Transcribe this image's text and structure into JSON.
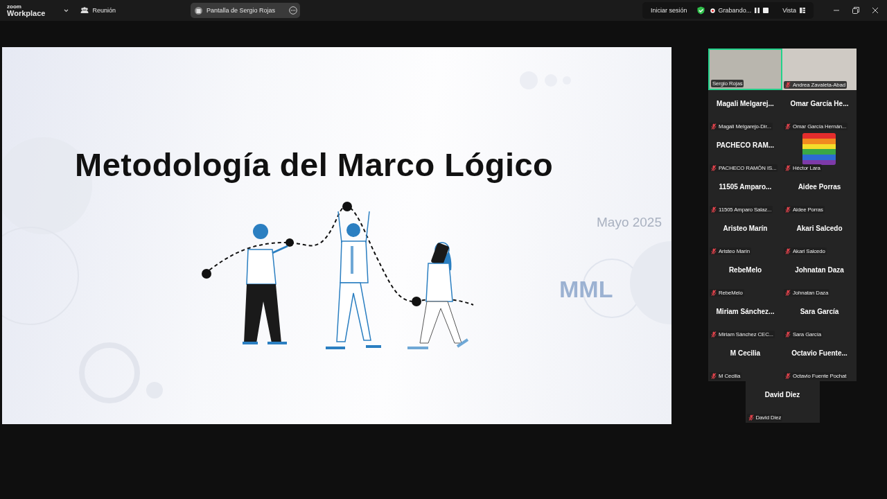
{
  "top_bar": {
    "brand_small": "zoom",
    "brand": "Workplace",
    "meeting_label": "Reunión",
    "share_label": "Pantalla de Sergio Rojas",
    "sign_in": "Iniciar sesión",
    "recording": "Grabando...",
    "view": "Vista"
  },
  "slide": {
    "title": "Metodología del Marco Lógico",
    "date": "Mayo 2025",
    "acronym": "MML"
  },
  "participants": [
    {
      "kind": "video",
      "label": "Sergio Rojas",
      "speaking": true,
      "muted": false
    },
    {
      "kind": "video",
      "label": "Andrea Zavaleta-Abad",
      "speaking": false,
      "muted": true
    },
    {
      "kind": "name",
      "display_name": "Magali  Melgarej...",
      "label": "Magali Melgarejo-Dir...",
      "speaking": false,
      "muted": true
    },
    {
      "kind": "name",
      "display_name": "Omar  García  He...",
      "label": "Omar García Hernán...",
      "speaking": false,
      "muted": true
    },
    {
      "kind": "name",
      "display_name": "PACHECO  RAM...",
      "label": "PACHECO RAMÓN IS...",
      "speaking": false,
      "muted": true
    },
    {
      "kind": "logo",
      "label": "Héctor Lara",
      "speaking": false,
      "muted": true
    },
    {
      "kind": "name",
      "display_name": "11505  Amparo...",
      "label": "11505 Amparo Salaz...",
      "speaking": false,
      "muted": true
    },
    {
      "kind": "name",
      "display_name": "Aidee Porras",
      "label": "Aidee Porras",
      "speaking": false,
      "muted": true
    },
    {
      "kind": "name",
      "display_name": "Aristeo Marín",
      "label": "Aristeo Marín",
      "speaking": false,
      "muted": true
    },
    {
      "kind": "name",
      "display_name": "Akari Salcedo",
      "label": "Akari Salcedo",
      "speaking": false,
      "muted": true
    },
    {
      "kind": "name",
      "display_name": "RebeMelo",
      "label": "RebeMelo",
      "speaking": false,
      "muted": true
    },
    {
      "kind": "name",
      "display_name": "Johnatan Daza",
      "label": "Johnatan Daza",
      "speaking": false,
      "muted": true
    },
    {
      "kind": "name",
      "display_name": "Miriam  Sánchez...",
      "label": "Miriam Sánchez CEC...",
      "speaking": false,
      "muted": true
    },
    {
      "kind": "name",
      "display_name": "Sara García",
      "label": "Sara García",
      "speaking": false,
      "muted": true
    },
    {
      "kind": "name",
      "display_name": "M Cecilia",
      "label": "M Cecilia",
      "speaking": false,
      "muted": true
    },
    {
      "kind": "name",
      "display_name": "Octavio  Fuente...",
      "label": "Octavio Fuente Pochat",
      "speaking": false,
      "muted": true
    },
    {
      "kind": "name",
      "display_name": "David Diez",
      "label": "David Diez",
      "speaking": false,
      "muted": true
    }
  ]
}
